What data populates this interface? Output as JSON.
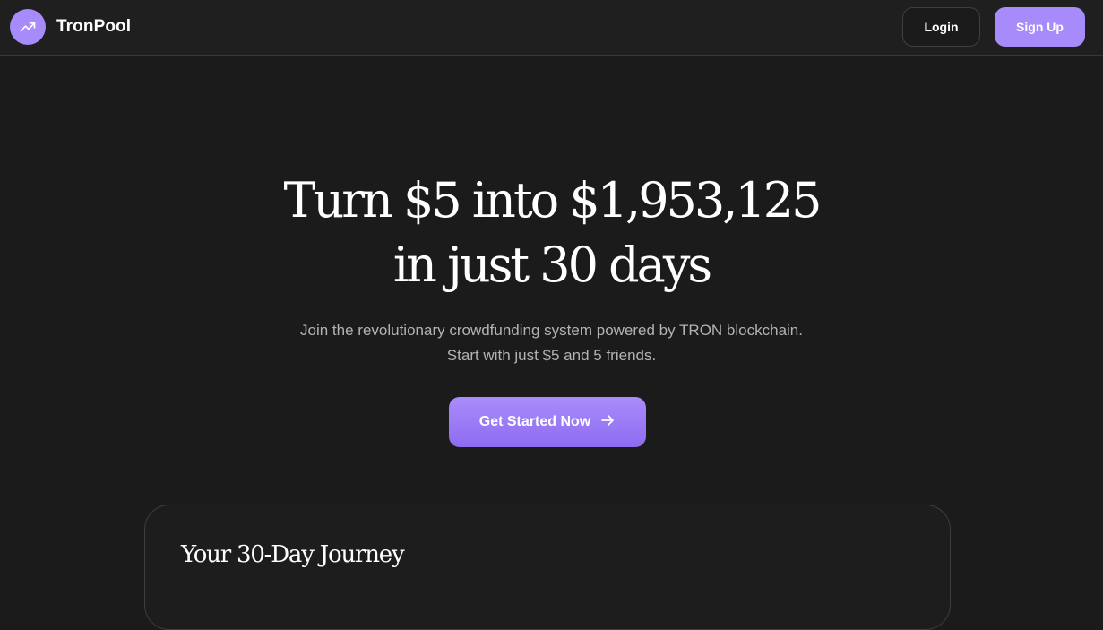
{
  "header": {
    "brand_name": "TronPool",
    "logo_icon": "trending-up-icon",
    "login_label": "Login",
    "signup_label": "Sign Up"
  },
  "hero": {
    "title_line1": "Turn $5 into $1,953,125",
    "title_line2": "in just 30 days",
    "subtitle_line1": "Join the revolutionary crowdfunding system powered by TRON blockchain.",
    "subtitle_line2": "Start with just $5 and 5 friends.",
    "cta_label": "Get Started Now",
    "cta_icon": "arrow-right-icon"
  },
  "journey": {
    "title": "Your 30-Day Journey"
  },
  "colors": {
    "background": "#1b1b1b",
    "accent": "#a78bfa",
    "text_primary": "#ffffff",
    "text_muted": "#b3b3b3"
  }
}
